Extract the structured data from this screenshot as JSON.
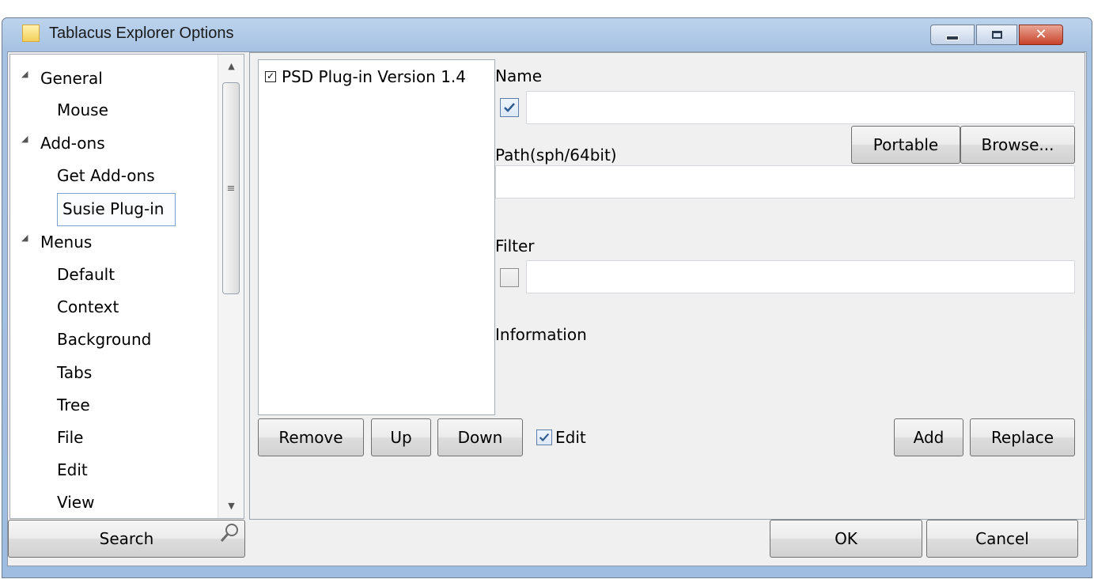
{
  "window": {
    "title": "Tablacus Explorer Options"
  },
  "nav": {
    "items": [
      {
        "label": "General",
        "level": 0,
        "expanded": true
      },
      {
        "label": "Mouse",
        "level": 1
      },
      {
        "label": "Add-ons",
        "level": 0,
        "expanded": true
      },
      {
        "label": "Get Add-ons",
        "level": 1
      },
      {
        "label": "Susie Plug-in",
        "level": 1,
        "selected": true
      },
      {
        "label": "Menus",
        "level": 0,
        "expanded": true
      },
      {
        "label": "Default",
        "level": 1
      },
      {
        "label": "Context",
        "level": 1
      },
      {
        "label": "Background",
        "level": 1
      },
      {
        "label": "Tabs",
        "level": 1
      },
      {
        "label": "Tree",
        "level": 1
      },
      {
        "label": "File",
        "level": 1
      },
      {
        "label": "Edit",
        "level": 1
      },
      {
        "label": "View",
        "level": 1
      }
    ],
    "search_label": "Search"
  },
  "plugins": {
    "items": [
      {
        "label": "PSD Plug-in Version 1.4",
        "checked": true
      }
    ]
  },
  "form": {
    "name_label": "Name",
    "name_checked": true,
    "name_value": "",
    "path_label": "Path(sph/64bit)",
    "portable_label": "Portable",
    "browse_label": "Browse...",
    "path_value": "",
    "filter_label": "Filter",
    "filter_checked": false,
    "filter_value": "",
    "information_label": "Information"
  },
  "list_buttons": {
    "remove": "Remove",
    "up": "Up",
    "down": "Down",
    "edit_label": "Edit",
    "edit_checked": true,
    "add": "Add",
    "replace": "Replace"
  },
  "dialog": {
    "ok": "OK",
    "cancel": "Cancel"
  },
  "colors": {
    "titlebar": "#a6c2e2",
    "close_button": "#c8432b",
    "selection_border": "#7da2ce",
    "check_blue": "#2f5d93"
  }
}
